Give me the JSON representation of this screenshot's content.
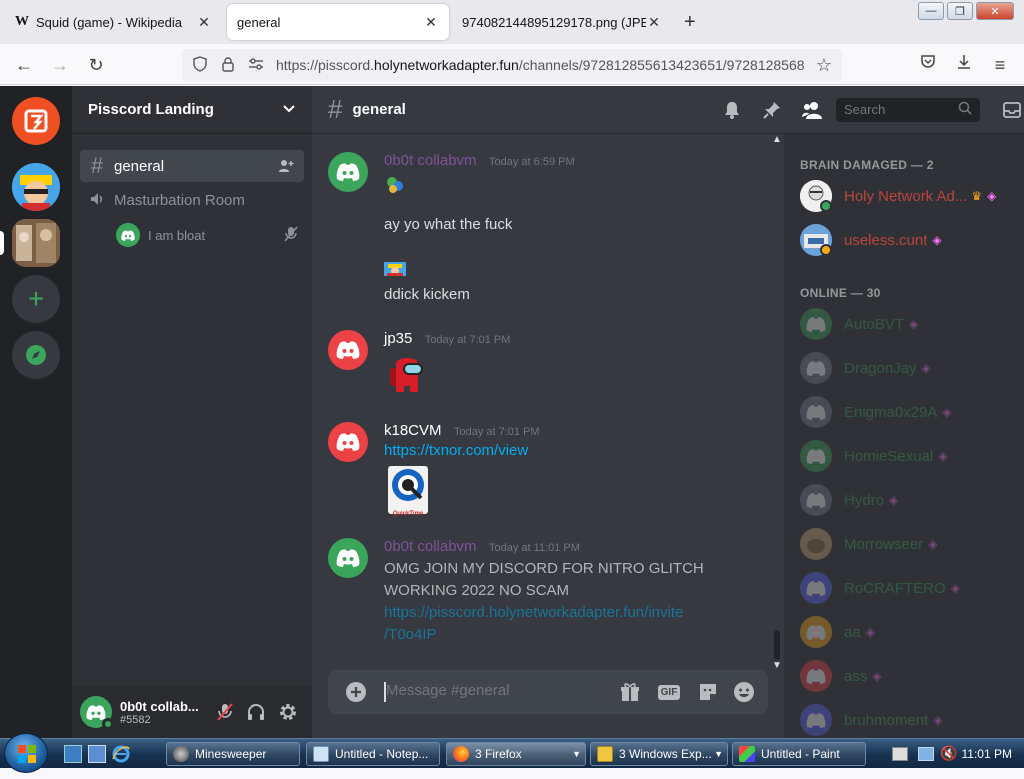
{
  "browser": {
    "tabs": [
      {
        "label": "Squid (game) - Wikipedia",
        "favicon": "W"
      },
      {
        "label": "general",
        "favicon": ""
      },
      {
        "label": "974082144895129178.png (JPEG Image",
        "favicon": ""
      }
    ],
    "url_host": "https://pisscord.",
    "url_domain": "holynetworkadapter.fun",
    "url_path": "/channels/972812855613423651/9728128568"
  },
  "discord": {
    "guild_name": "Pisscord Landing",
    "channels": [
      {
        "label": "general",
        "type": "text"
      },
      {
        "label": "Masturbation Room",
        "type": "voice"
      }
    ],
    "voice_user": "I am bloat",
    "current_user": {
      "name": "0b0t collab...",
      "tag": "#5582"
    },
    "header_channel": "general",
    "search_placeholder": "Search",
    "messages": [
      {
        "author": "0b0t collabvm",
        "time": "Today at 6:59 PM",
        "author_color": "#9b59b6"
      },
      {
        "author": "jp35",
        "time": "Today at 7:01 PM",
        "author_color": "#ffffff"
      },
      {
        "author": "k18CVM",
        "time": "Today at 7:01 PM",
        "author_color": "#ffffff"
      },
      {
        "author": "0b0t collabvm",
        "time": "Today at 11:01 PM",
        "author_color": "#9b59b6"
      }
    ],
    "lines": {
      "ayyo": "ay yo what the fuck",
      "ddick": "ddick kickem",
      "txnor_link": "https://txnor.com/view",
      "quicktime_label": "QuickTime",
      "omg": "OMG JOIN MY DISCORD FOR NITRO GLITCH",
      "working": "WORKING 2022 NO SCAM",
      "invite_1": "https://pisscord.holynetworkadapter.fun/invite",
      "invite_2": "/T0o4IP"
    },
    "composer_placeholder": "Message #general",
    "gif_label": "GIF",
    "member_groups": {
      "brain_damaged": "BRAIN DAMAGED — 2",
      "online": "ONLINE — 30"
    },
    "members_brain": [
      {
        "name": "Holy Network Ad...",
        "color": "#e74c3c",
        "crown": true
      },
      {
        "name": "useless.cunt",
        "color": "#e74c3c",
        "crown": false
      }
    ],
    "members_online": [
      {
        "name": "AutoBVT",
        "avatar_color": "#3ba55c"
      },
      {
        "name": "DragonJay",
        "avatar_color": "#747f8d"
      },
      {
        "name": "Enigma0x29A",
        "avatar_color": "#747f8d"
      },
      {
        "name": "HomieSexual",
        "avatar_color": "#3ba55c"
      },
      {
        "name": "Hydro",
        "avatar_color": "#747f8d"
      },
      {
        "name": "Morrowseer",
        "avatar_color": "#a0805a"
      },
      {
        "name": "RoCRAFTERO",
        "avatar_color": "#5865f2"
      },
      {
        "name": "aa",
        "avatar_color": "#faa61a"
      },
      {
        "name": "ass",
        "avatar_color": "#ed4245"
      },
      {
        "name": "bruhmoment",
        "avatar_color": "#5865f2"
      }
    ]
  },
  "taskbar": {
    "items": [
      {
        "label": "Minesweeper"
      },
      {
        "label": "Untitled - Notep..."
      },
      {
        "label": "3 Firefox"
      },
      {
        "label": "3 Windows Exp..."
      },
      {
        "label": "Untitled - Paint"
      }
    ],
    "clock": "11:01 PM"
  }
}
